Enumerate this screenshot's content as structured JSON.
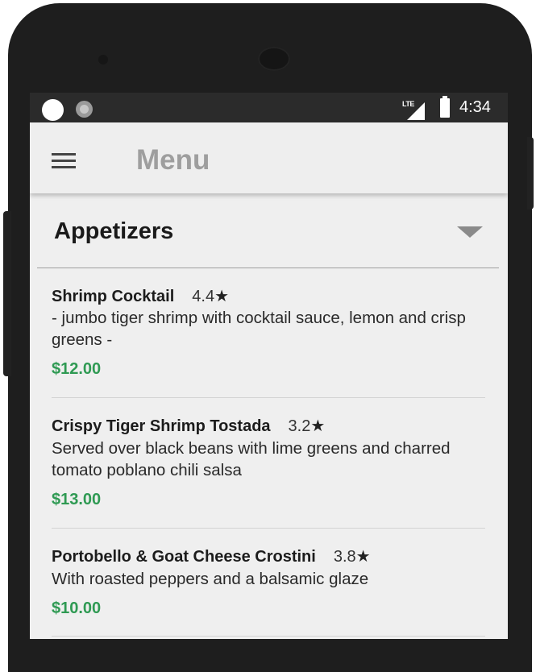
{
  "status_bar": {
    "network": "LTE",
    "time": "4:34"
  },
  "app_bar": {
    "menu_icon": "hamburger-menu-icon",
    "title": "Menu"
  },
  "section": {
    "title": "Appetizers",
    "expand_icon": "caret-down-icon",
    "expanded": true
  },
  "items": [
    {
      "name": "Shrimp Cocktail",
      "rating": "4.4",
      "description": "- jumbo tiger shrimp with cocktail sauce, lemon and crisp greens -",
      "price": "$12.00"
    },
    {
      "name": "Crispy Tiger Shrimp Tostada",
      "rating": "3.2",
      "description": "Served over black beans with lime greens and charred tomato poblano chili salsa",
      "price": "$13.00"
    },
    {
      "name": "Portobello & Goat Cheese Crostini",
      "rating": "3.8",
      "description": "With roasted peppers and a balsamic glaze",
      "price": "$10.00"
    }
  ],
  "colors": {
    "price": "#2f9a53",
    "title_grey": "#9e9e9e",
    "status_bar": "#2b2b2b",
    "screen_bg": "#efefef"
  }
}
